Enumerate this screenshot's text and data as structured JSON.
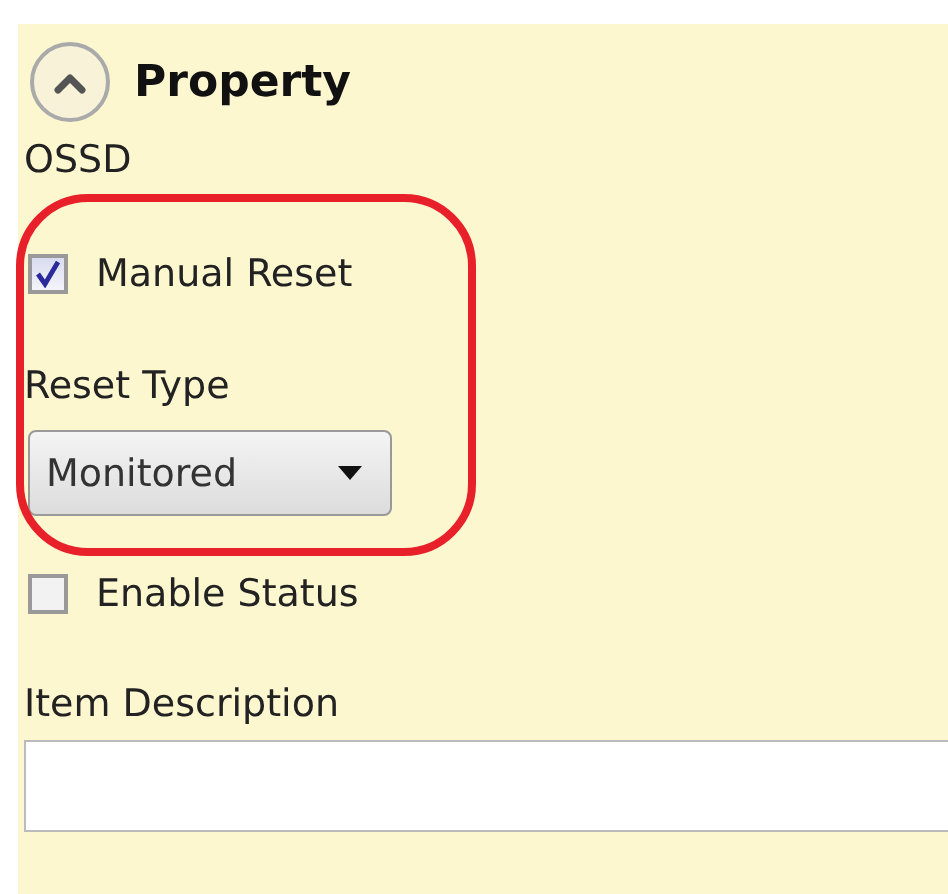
{
  "section": {
    "title": "Property",
    "expanded": true
  },
  "group_label": "OSSD",
  "manual_reset": {
    "label": "Manual Reset",
    "checked": true
  },
  "reset_type": {
    "label": "Reset Type",
    "value": "Monitored"
  },
  "enable_status": {
    "label": "Enable Status",
    "checked": false
  },
  "item_description": {
    "label": "Item Description"
  }
}
